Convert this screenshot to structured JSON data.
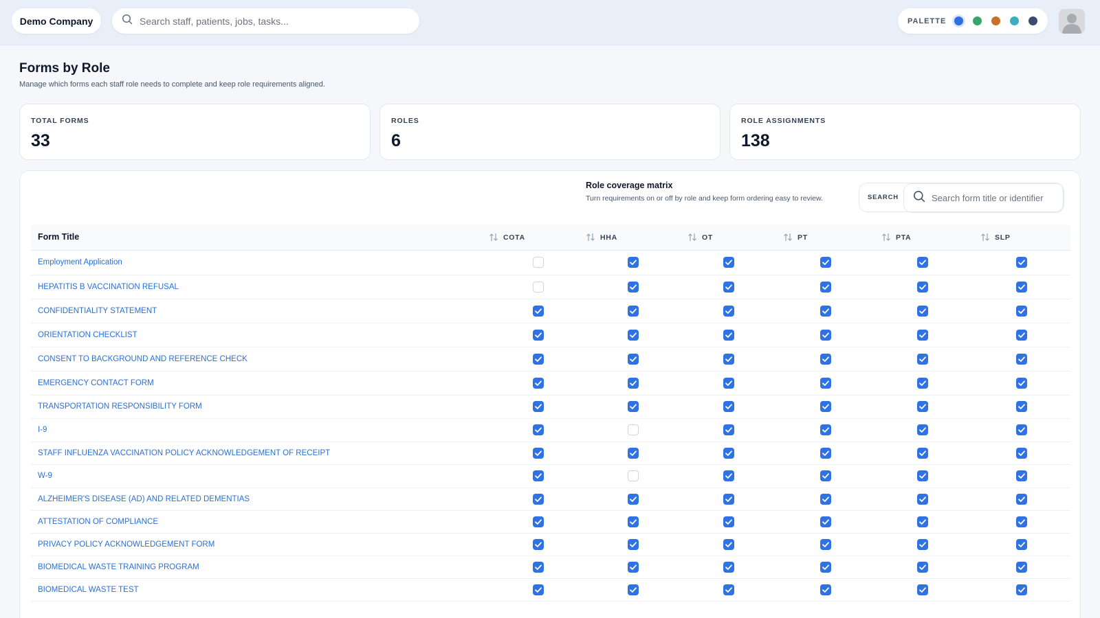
{
  "header": {
    "company": "Demo Company",
    "search_placeholder": "Search staff, patients, jobs, tasks...",
    "palette_label": "PALETTE",
    "palette_colors": [
      "#2f6fe4",
      "#3aa56b",
      "#c9702c",
      "#3aaec0",
      "#3d4a6b"
    ]
  },
  "page": {
    "title": "Forms by Role",
    "subtitle": "Manage which forms each staff role needs to complete and keep role requirements aligned."
  },
  "stats": [
    {
      "label": "TOTAL FORMS",
      "value": "33"
    },
    {
      "label": "ROLES",
      "value": "6"
    },
    {
      "label": "ROLE ASSIGNMENTS",
      "value": "138"
    }
  ],
  "matrix": {
    "title": "Role coverage matrix",
    "subtitle": "Turn requirements on or off by role and keep form ordering easy to review.",
    "search_label": "SEARCH",
    "search_placeholder": "Search form title or identifier",
    "column_title": "Form Title",
    "roles": [
      "COTA",
      "HHA",
      "OT",
      "PT",
      "PTA",
      "SLP"
    ],
    "rows": [
      {
        "title": "Employment Application",
        "checks": [
          false,
          true,
          true,
          true,
          true,
          true
        ]
      },
      {
        "title": "HEPATITIS B VACCINATION REFUSAL",
        "checks": [
          false,
          true,
          true,
          true,
          true,
          true
        ]
      },
      {
        "title": "CONFIDENTIALITY STATEMENT",
        "checks": [
          true,
          true,
          true,
          true,
          true,
          true
        ]
      },
      {
        "title": "ORIENTATION CHECKLIST",
        "checks": [
          true,
          true,
          true,
          true,
          true,
          true
        ]
      },
      {
        "title": "CONSENT TO BACKGROUND AND REFERENCE CHECK",
        "checks": [
          true,
          true,
          true,
          true,
          true,
          true
        ]
      },
      {
        "title": "EMERGENCY CONTACT FORM",
        "checks": [
          true,
          true,
          true,
          true,
          true,
          true
        ]
      },
      {
        "title": "TRANSPORTATION RESPONSIBILITY FORM",
        "checks": [
          true,
          true,
          true,
          true,
          true,
          true
        ]
      },
      {
        "title": "I-9",
        "checks": [
          true,
          false,
          true,
          true,
          true,
          true
        ]
      },
      {
        "title": "STAFF INFLUENZA VACCINATION POLICY ACKNOWLEDGEMENT OF RECEIPT",
        "checks": [
          true,
          true,
          true,
          true,
          true,
          true
        ]
      },
      {
        "title": "W-9",
        "checks": [
          true,
          false,
          true,
          true,
          true,
          true
        ]
      },
      {
        "title": "ALZHEIMER'S DISEASE (AD) AND RELATED DEMENTIAS",
        "checks": [
          true,
          true,
          true,
          true,
          true,
          true
        ]
      },
      {
        "title": "ATTESTATION OF COMPLIANCE",
        "checks": [
          true,
          true,
          true,
          true,
          true,
          true
        ]
      },
      {
        "title": "PRIVACY POLICY ACKNOWLEDGEMENT FORM",
        "checks": [
          true,
          true,
          true,
          true,
          true,
          true
        ]
      },
      {
        "title": "BIOMEDICAL WASTE TRAINING PROGRAM",
        "checks": [
          true,
          true,
          true,
          true,
          true,
          true
        ]
      },
      {
        "title": "BIOMEDICAL WASTE TEST",
        "checks": [
          true,
          true,
          true,
          true,
          true,
          true
        ]
      }
    ]
  }
}
